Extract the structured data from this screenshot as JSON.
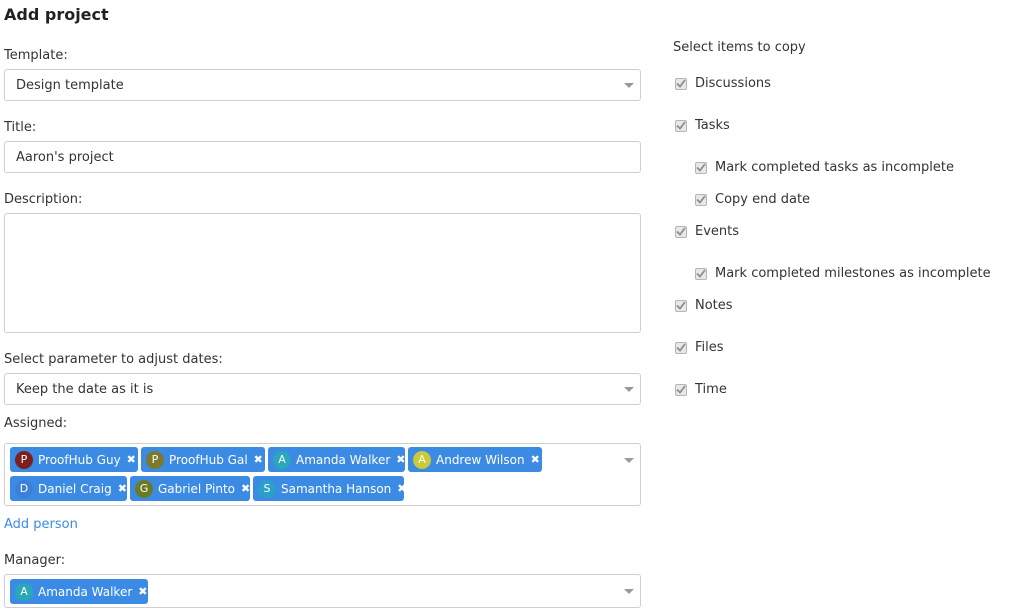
{
  "page": {
    "title": "Add project"
  },
  "form": {
    "template_label": "Template:",
    "template_value": "Design template",
    "title_label": "Title:",
    "title_value": "Aaron's project",
    "description_label": "Description:",
    "description_value": "",
    "dates_label": "Select parameter to adjust dates:",
    "dates_value": "Keep the date as it is",
    "assigned_label": "Assigned:",
    "assigned": [
      {
        "name": "ProofHub Guy",
        "initial": "P",
        "color": "#7d1f1f"
      },
      {
        "name": "ProofHub Gal",
        "initial": "P",
        "color": "#7a7a2a"
      },
      {
        "name": "Amanda Walker",
        "initial": "A",
        "color": "#2aa7b8"
      },
      {
        "name": "Andrew Wilson",
        "initial": "A",
        "color": "#c9c93a"
      },
      {
        "name": "Daniel Craig",
        "initial": "D",
        "color": "#3b7fd6"
      },
      {
        "name": "Gabriel Pinto",
        "initial": "G",
        "color": "#6b7a26"
      },
      {
        "name": "Samantha Hanson",
        "initial": "S",
        "color": "#2a9fc9"
      }
    ],
    "add_person_label": "Add person",
    "manager_label": "Manager:",
    "manager": {
      "name": "Amanda Walker",
      "initial": "A",
      "color": "#2aa7b8"
    },
    "remove_glyph": "✖"
  },
  "copy_items": {
    "heading": "Select items to copy",
    "items": [
      {
        "label": "Discussions",
        "checked": true
      },
      {
        "label": "Tasks",
        "checked": true
      },
      {
        "label": "Mark completed tasks as incomplete",
        "checked": true
      },
      {
        "label": "Copy end date",
        "checked": true
      },
      {
        "label": "Events",
        "checked": true
      },
      {
        "label": "Mark completed milestones as incomplete",
        "checked": true
      },
      {
        "label": "Notes",
        "checked": true
      },
      {
        "label": "Files",
        "checked": true
      },
      {
        "label": "Time",
        "checked": true
      }
    ]
  },
  "colors": {
    "accent": "#3b8be5",
    "border": "#cfcfcf"
  }
}
